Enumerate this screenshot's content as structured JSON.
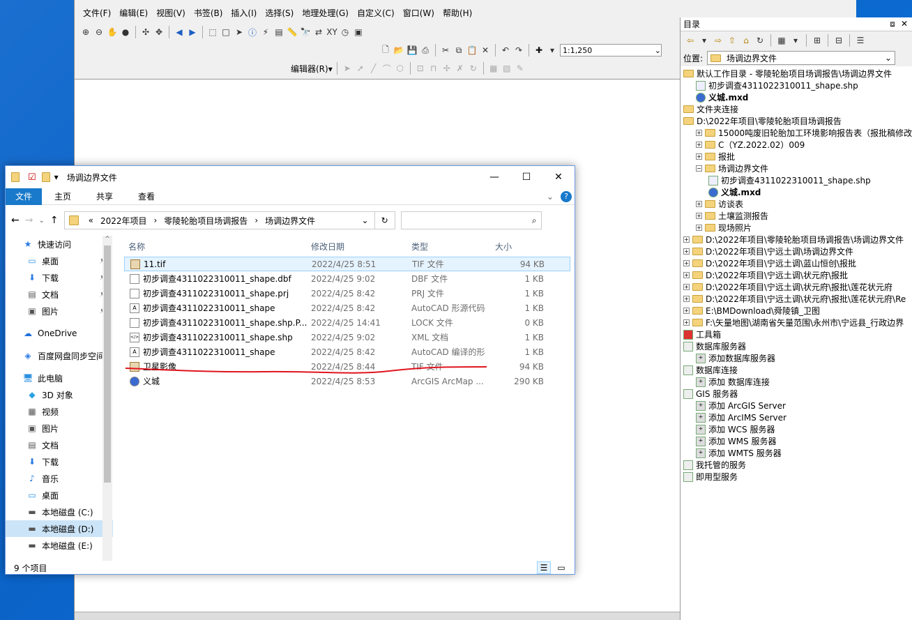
{
  "arcmap": {
    "menus": [
      "文件(F)",
      "编辑(E)",
      "视图(V)",
      "书签(B)",
      "插入(I)",
      "选择(S)",
      "地理处理(G)",
      "自定义(C)",
      "窗口(W)",
      "帮助(H)"
    ],
    "scale": "1:1,250",
    "editor_label": "编辑器(R)▾"
  },
  "catalog": {
    "title": "目录",
    "location_label": "位置:",
    "location_value": "场调边界文件",
    "tree": [
      {
        "level": 0,
        "icon": "folder",
        "exp": "",
        "label": "默认工作目录 - 零陵轮胎项目场调报告\\场调边界文件",
        "bold": false
      },
      {
        "level": 1,
        "icon": "shp",
        "exp": "",
        "label": "初步调查4311022310011_shape.shp",
        "bold": false
      },
      {
        "level": 1,
        "icon": "mxd",
        "exp": "",
        "label": "义城.mxd",
        "bold": true
      },
      {
        "level": 0,
        "icon": "folder",
        "exp": "",
        "label": "文件夹连接",
        "bold": false
      },
      {
        "level": 0,
        "icon": "folder",
        "exp": "",
        "label": "D:\\2022年项目\\零陵轮胎项目场调报告",
        "bold": false
      },
      {
        "level": 1,
        "icon": "folder",
        "exp": "+",
        "label": "15000吨废旧轮胎加工环境影响报告表（报批稿修改",
        "bold": false
      },
      {
        "level": 1,
        "icon": "folder",
        "exp": "+",
        "label": "C（YZ.2022.02）009",
        "bold": false
      },
      {
        "level": 1,
        "icon": "folder",
        "exp": "+",
        "label": "报批",
        "bold": false
      },
      {
        "level": 1,
        "icon": "folder",
        "exp": "−",
        "label": "场调边界文件",
        "bold": false
      },
      {
        "level": 2,
        "icon": "shp",
        "exp": "",
        "label": "初步调查4311022310011_shape.shp",
        "bold": false
      },
      {
        "level": 2,
        "icon": "mxd",
        "exp": "",
        "label": "义城.mxd",
        "bold": true
      },
      {
        "level": 1,
        "icon": "folder",
        "exp": "+",
        "label": "访谈表",
        "bold": false
      },
      {
        "level": 1,
        "icon": "folder",
        "exp": "+",
        "label": "土壤监测报告",
        "bold": false
      },
      {
        "level": 1,
        "icon": "folder",
        "exp": "+",
        "label": "现场照片",
        "bold": false
      },
      {
        "level": 0,
        "icon": "folder",
        "exp": "+",
        "label": "D:\\2022年项目\\零陵轮胎项目场调报告\\场调边界文件",
        "bold": false
      },
      {
        "level": 0,
        "icon": "folder",
        "exp": "+",
        "label": "D:\\2022年项目\\宁远土调\\场调边界文件",
        "bold": false
      },
      {
        "level": 0,
        "icon": "folder",
        "exp": "+",
        "label": "D:\\2022年项目\\宁远土调\\蓝山恒创\\报批",
        "bold": false
      },
      {
        "level": 0,
        "icon": "folder",
        "exp": "+",
        "label": "D:\\2022年项目\\宁远土调\\状元府\\报批",
        "bold": false
      },
      {
        "level": 0,
        "icon": "folder",
        "exp": "+",
        "label": "D:\\2022年项目\\宁远土调\\状元府\\报批\\莲花状元府",
        "bold": false
      },
      {
        "level": 0,
        "icon": "folder",
        "exp": "+",
        "label": "D:\\2022年项目\\宁远土调\\状元府\\报批\\莲花状元府\\Re",
        "bold": false
      },
      {
        "level": 0,
        "icon": "folder",
        "exp": "+",
        "label": "E:\\BMDownload\\舜陵镇_卫图",
        "bold": false
      },
      {
        "level": 0,
        "icon": "folder",
        "exp": "+",
        "label": "F:\\矢量地图\\湖南省矢量范围\\永州市\\宁远县_行政边界",
        "bold": false
      },
      {
        "level": 0,
        "icon": "tool",
        "exp": "",
        "label": "工具箱",
        "bold": false
      },
      {
        "level": 0,
        "icon": "db",
        "exp": "",
        "label": "数据库服务器",
        "bold": false
      },
      {
        "level": 1,
        "icon": "add",
        "exp": "",
        "label": "添加数据库服务器",
        "bold": false
      },
      {
        "level": 0,
        "icon": "db",
        "exp": "",
        "label": "数据库连接",
        "bold": false
      },
      {
        "level": 1,
        "icon": "add",
        "exp": "",
        "label": "添加 数据库连接",
        "bold": false
      },
      {
        "level": 0,
        "icon": "db",
        "exp": "",
        "label": "GIS 服务器",
        "bold": false
      },
      {
        "level": 1,
        "icon": "add",
        "exp": "",
        "label": "添加 ArcGIS Server",
        "bold": false
      },
      {
        "level": 1,
        "icon": "add",
        "exp": "",
        "label": "添加 ArcIMS Server",
        "bold": false
      },
      {
        "level": 1,
        "icon": "add",
        "exp": "",
        "label": "添加 WCS 服务器",
        "bold": false
      },
      {
        "level": 1,
        "icon": "add",
        "exp": "",
        "label": "添加 WMS 服务器",
        "bold": false
      },
      {
        "level": 1,
        "icon": "add",
        "exp": "",
        "label": "添加 WMTS 服务器",
        "bold": false
      },
      {
        "level": 0,
        "icon": "db",
        "exp": "",
        "label": "我托管的服务",
        "bold": false
      },
      {
        "level": 0,
        "icon": "db",
        "exp": "",
        "label": "即用型服务",
        "bold": false
      }
    ]
  },
  "explorer": {
    "title": "场调边界文件",
    "tabs": [
      "文件",
      "主页",
      "共享",
      "查看"
    ],
    "breadcrumb": [
      "2022年项目",
      "零陵轮胎项目场调报告",
      "场调边界文件"
    ],
    "breadcrumb_prefix": "«",
    "columns": [
      "名称",
      "修改日期",
      "类型",
      "大小"
    ],
    "files": [
      {
        "name": "11.tif",
        "date": "2022/4/25 8:51",
        "type": "TIF 文件",
        "size": "94 KB",
        "icon": "tif"
      },
      {
        "name": "初步调查4311022310011_shape.dbf",
        "date": "2022/4/25 9:02",
        "type": "DBF 文件",
        "size": "1 KB",
        "icon": "doc"
      },
      {
        "name": "初步调查4311022310011_shape.prj",
        "date": "2022/4/25 8:42",
        "type": "PRJ 文件",
        "size": "1 KB",
        "icon": "doc"
      },
      {
        "name": "初步调查4311022310011_shape",
        "date": "2022/4/25 8:42",
        "type": "AutoCAD 形源代码",
        "size": "1 KB",
        "icon": "cad"
      },
      {
        "name": "初步调查4311022310011_shape.shp.P...",
        "date": "2022/4/25 14:41",
        "type": "LOCK 文件",
        "size": "0 KB",
        "icon": "doc"
      },
      {
        "name": "初步调查4311022310011_shape.shp",
        "date": "2022/4/25 9:02",
        "type": "XML 文档",
        "size": "1 KB",
        "icon": "xml"
      },
      {
        "name": "初步调查4311022310011_shape",
        "date": "2022/4/25 8:42",
        "type": "AutoCAD 编译的形",
        "size": "1 KB",
        "icon": "cad"
      },
      {
        "name": "卫星影像",
        "date": "2022/4/25 8:44",
        "type": "TIF 文件",
        "size": "94 KB",
        "icon": "tif"
      },
      {
        "name": "义城",
        "date": "2022/4/25 8:53",
        "type": "ArcGIS ArcMap ...",
        "size": "290 KB",
        "icon": "mxd"
      }
    ],
    "nav": [
      {
        "label": "快速访问",
        "icon": "star-icon",
        "pin": false,
        "sub": false,
        "sel": false
      },
      {
        "label": "桌面",
        "icon": "desktop-icon",
        "pin": true,
        "sub": true,
        "sel": false
      },
      {
        "label": "下载",
        "icon": "download-icon",
        "pin": true,
        "sub": true,
        "sel": false
      },
      {
        "label": "文档",
        "icon": "document-icon",
        "pin": true,
        "sub": true,
        "sel": false
      },
      {
        "label": "图片",
        "icon": "pictures-icon",
        "pin": true,
        "sub": true,
        "sel": false
      },
      {
        "label": "",
        "icon": "",
        "pin": false,
        "sub": false,
        "sel": false
      },
      {
        "label": "OneDrive",
        "icon": "cloud-icon",
        "pin": false,
        "sub": false,
        "sel": false
      },
      {
        "label": "",
        "icon": "",
        "pin": false,
        "sub": false,
        "sel": false
      },
      {
        "label": "百度网盘同步空间",
        "icon": "baidu-icon",
        "pin": false,
        "sub": false,
        "sel": false
      },
      {
        "label": "",
        "icon": "",
        "pin": false,
        "sub": false,
        "sel": false
      },
      {
        "label": "此电脑",
        "icon": "computer-icon",
        "pin": false,
        "sub": false,
        "sel": false
      },
      {
        "label": "3D 对象",
        "icon": "cube-icon",
        "pin": false,
        "sub": true,
        "sel": false
      },
      {
        "label": "视频",
        "icon": "video-icon",
        "pin": false,
        "sub": true,
        "sel": false
      },
      {
        "label": "图片",
        "icon": "pictures-icon",
        "pin": false,
        "sub": true,
        "sel": false
      },
      {
        "label": "文档",
        "icon": "document-icon",
        "pin": false,
        "sub": true,
        "sel": false
      },
      {
        "label": "下载",
        "icon": "download-icon",
        "pin": false,
        "sub": true,
        "sel": false
      },
      {
        "label": "音乐",
        "icon": "music-icon",
        "pin": false,
        "sub": true,
        "sel": false
      },
      {
        "label": "桌面",
        "icon": "desktop-icon",
        "pin": false,
        "sub": true,
        "sel": false
      },
      {
        "label": "本地磁盘 (C:)",
        "icon": "drive-icon",
        "pin": false,
        "sub": true,
        "sel": false
      },
      {
        "label": "本地磁盘 (D:)",
        "icon": "drive-icon",
        "pin": false,
        "sub": true,
        "sel": true
      },
      {
        "label": "本地磁盘 (E:)",
        "icon": "drive-icon",
        "pin": false,
        "sub": true,
        "sel": false
      }
    ],
    "status": "9 个项目"
  },
  "colors": {
    "accent": "#1979ca",
    "highlight_stroke": "#e0141e",
    "folder": "#f4d37c"
  }
}
